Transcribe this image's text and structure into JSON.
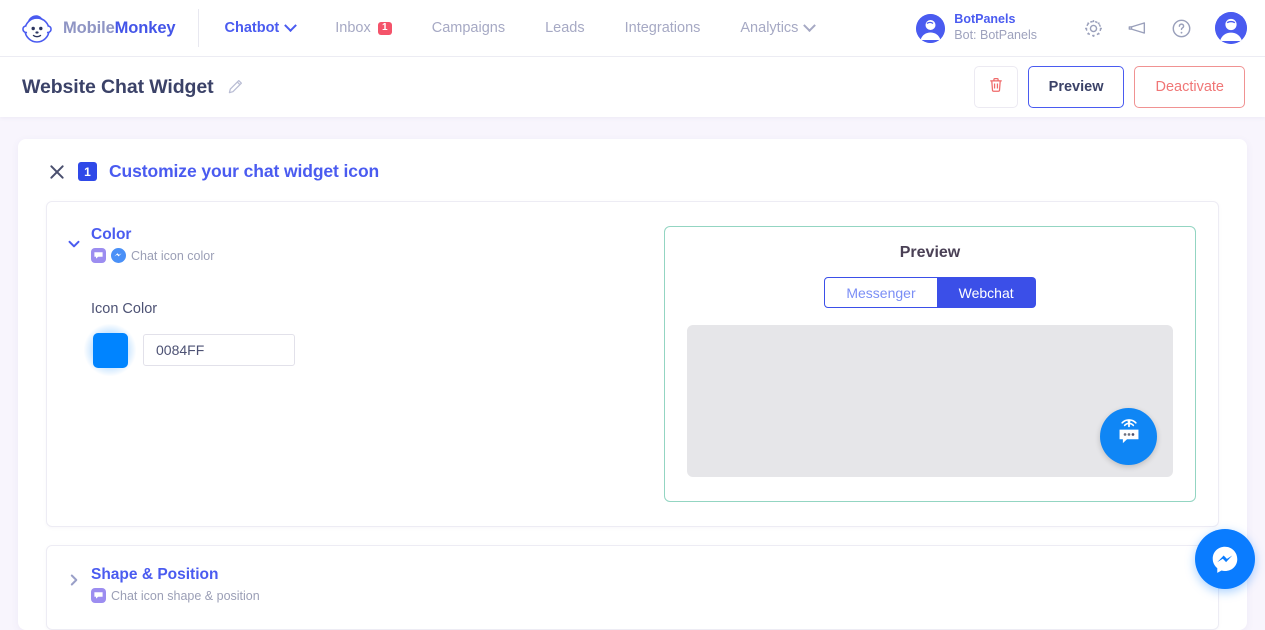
{
  "brand": {
    "name_part1": "Mobile",
    "name_part2": "Monkey",
    "logo_icon": "monkey-logo-icon"
  },
  "nav": {
    "items": [
      {
        "label": "Chatbot",
        "active": true,
        "has_chevron": true
      },
      {
        "label": "Inbox",
        "active": false,
        "badge": "1"
      },
      {
        "label": "Campaigns",
        "active": false
      },
      {
        "label": "Leads",
        "active": false
      },
      {
        "label": "Integrations",
        "active": false
      },
      {
        "label": "Analytics",
        "active": false,
        "has_chevron": true
      }
    ],
    "account": {
      "name": "BotPanels",
      "sub": "Bot: BotPanels",
      "avatar_icon": "bot-avatar-icon"
    },
    "icons": [
      "gear-icon",
      "megaphone-icon",
      "help-icon",
      "user-avatar-icon"
    ]
  },
  "titlebar": {
    "title": "Website Chat Widget",
    "edit_icon": "pencil-icon",
    "delete_icon": "trash-icon",
    "preview_label": "Preview",
    "deactivate_label": "Deactivate"
  },
  "section": {
    "step_number": "1",
    "title": "Customize your chat widget icon",
    "close_icon": "close-icon"
  },
  "color_group": {
    "title": "Color",
    "subtitle": "Chat icon color",
    "badges": [
      "webchat-bubble-icon",
      "messenger-icon"
    ],
    "field_label": "Icon Color",
    "color_value": "0084FF",
    "color_hex": "#0084FF",
    "expanded": true
  },
  "shape_group": {
    "title": "Shape & Position",
    "subtitle": "Chat icon shape & position",
    "badges": [
      "webchat-bubble-icon"
    ],
    "expanded": false
  },
  "preview": {
    "title": "Preview",
    "tabs": [
      {
        "label": "Messenger",
        "active": false
      },
      {
        "label": "Webchat",
        "active": true
      }
    ],
    "widget_icon": "broadcast-chat-bubble-icon",
    "widget_color": "#0f86f5",
    "canvas_color": "#e6e6e9",
    "border_color": "#93d5c2"
  },
  "floating": {
    "icon": "messenger-icon",
    "color": "#0a7cff"
  },
  "theme": {
    "page_background": "#f8f5fd",
    "accent_blue": "#4a5bf0",
    "danger_red": "#f07676",
    "badge_red": "#f4536a"
  }
}
